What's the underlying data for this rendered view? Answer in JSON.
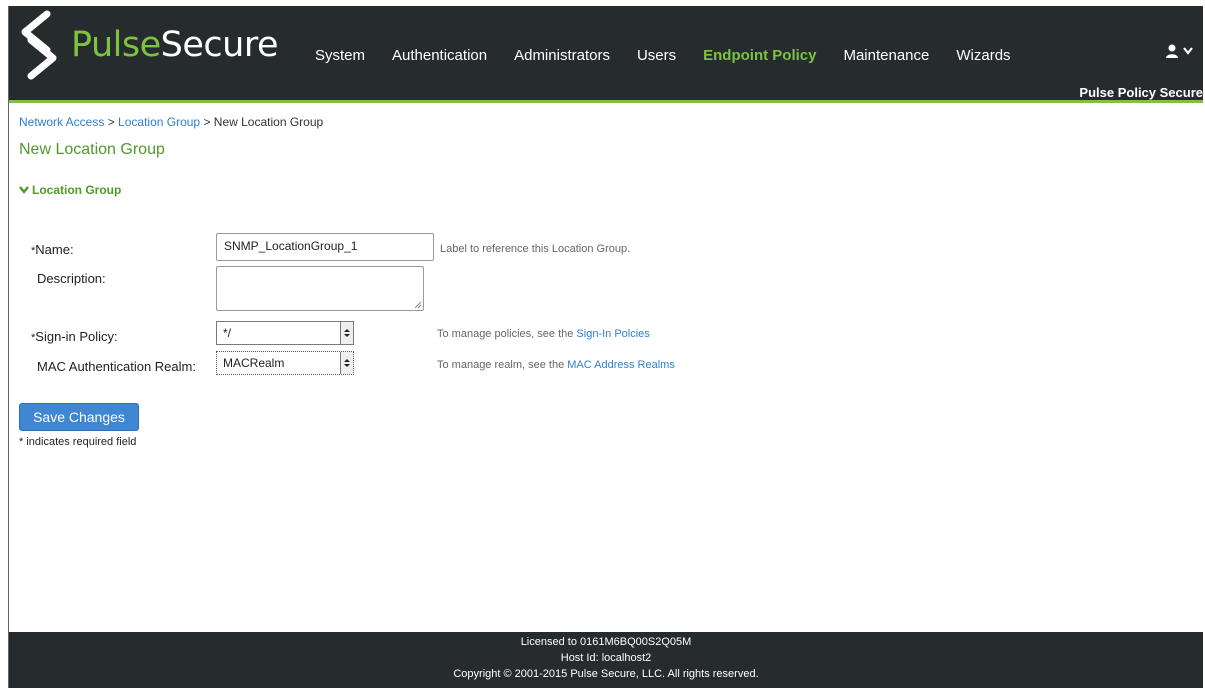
{
  "brand": {
    "pulse": "Pulse",
    "secure": "Secure",
    "product": "Pulse Policy Secure"
  },
  "nav": {
    "items": [
      "System",
      "Authentication",
      "Administrators",
      "Users",
      "Endpoint Policy",
      "Maintenance",
      "Wizards"
    ],
    "active": "Endpoint Policy"
  },
  "user_menu": {
    "icon": "user-icon",
    "chevron": "chevron-down-icon"
  },
  "breadcrumb": {
    "link1": "Network Access",
    "sep": " > ",
    "link2": "Location Group",
    "current": "New Location Group"
  },
  "page": {
    "title": "New Location Group",
    "section": "Location Group"
  },
  "form": {
    "name": {
      "required_mark": "*",
      "label": "Name:",
      "value": "SNMP_LocationGroup_1",
      "hint": "Label to reference this Location Group."
    },
    "description": {
      "label": "Description:",
      "value": ""
    },
    "signin_policy": {
      "required_mark": "*",
      "label": "Sign-in Policy:",
      "value": "*/",
      "hint_prefix": "To manage policies, see the ",
      "hint_link": "Sign-In Polcies"
    },
    "mac_realm": {
      "label": "MAC Authentication Realm:",
      "value": "MACRealm",
      "hint_prefix": "To manage realm, see the ",
      "hint_link": "MAC Address Realms"
    }
  },
  "actions": {
    "save": "Save Changes"
  },
  "required_note": "* indicates required field",
  "footer": {
    "license": "Licensed to 0161M6BQ00S2Q05M",
    "host": "Host Id: localhost2",
    "copyright": "Copyright © 2001-2015 Pulse Secure, LLC. All rights reserved."
  },
  "colors": {
    "header_bg": "#262b2e",
    "brand_green": "#7dc242",
    "link_blue": "#2f7fcd",
    "button_blue": "#3f86d3"
  }
}
